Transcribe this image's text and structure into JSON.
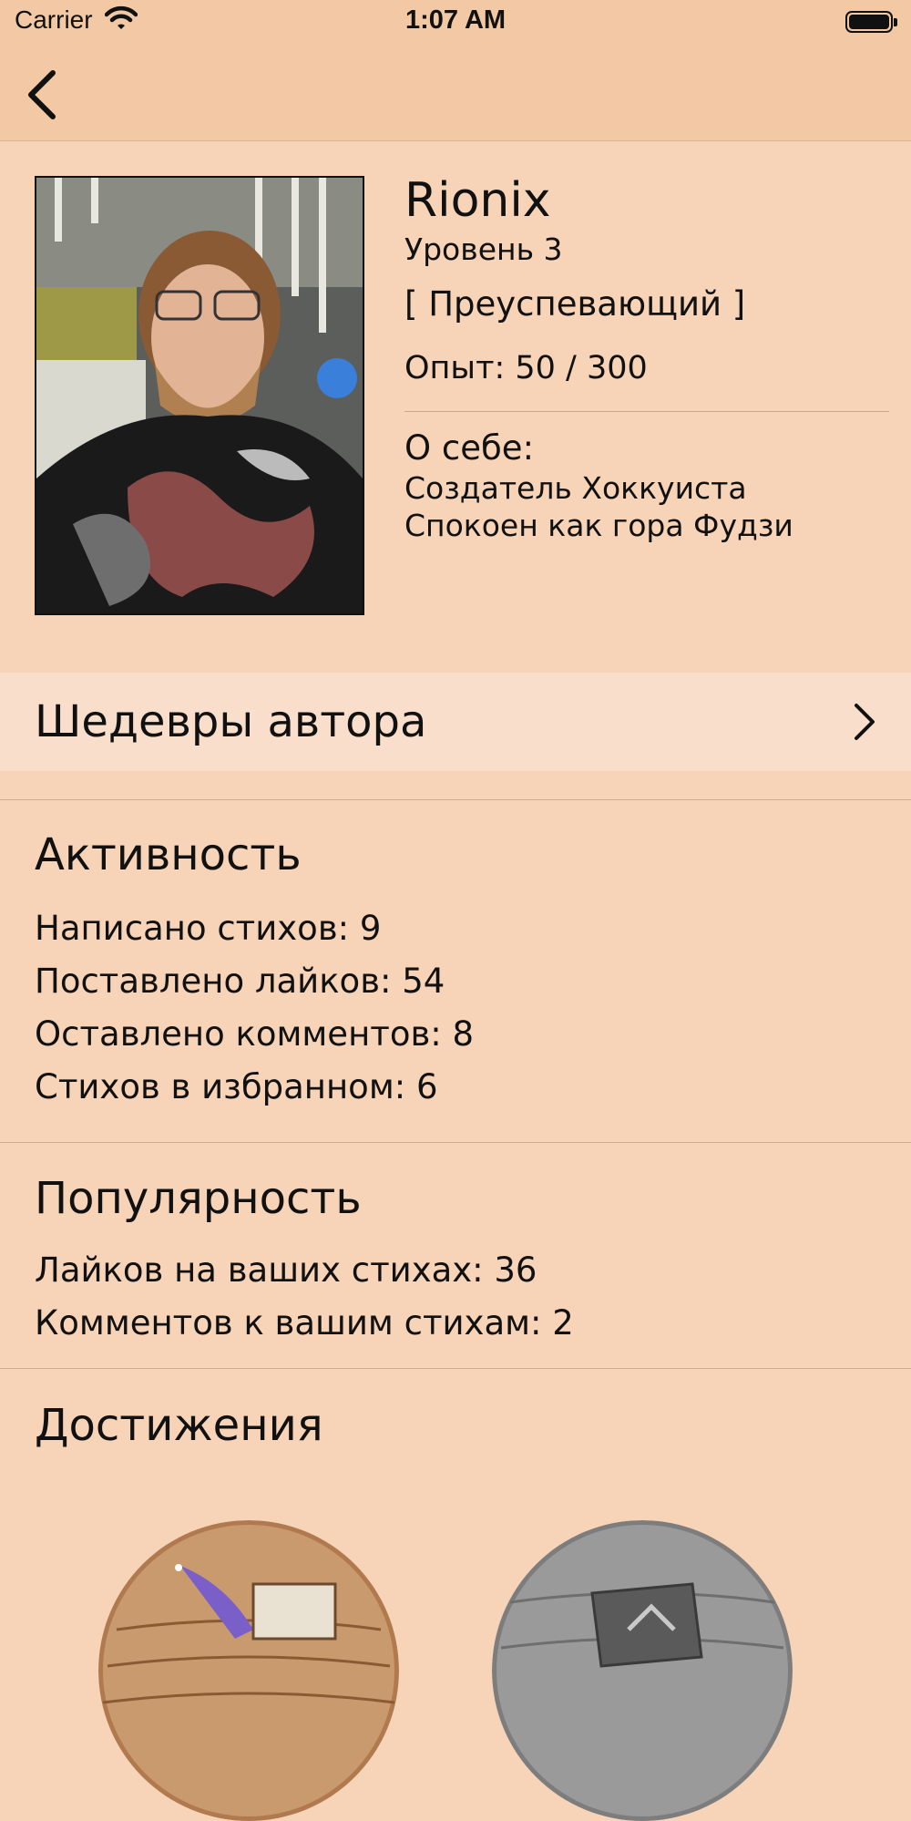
{
  "status_bar": {
    "carrier": "Carrier",
    "time": "1:07 AM"
  },
  "profile": {
    "name": "Rionix",
    "level": "Уровень 3",
    "rank": "[ Преуспевающий ]",
    "experience": "Опыт: 50 / 300",
    "about_label": "О себе:",
    "about_lines": [
      "Создатель Хоккуиста",
      "Спокоен как гора Фудзи"
    ]
  },
  "masterpieces": {
    "label": "Шедевры автора"
  },
  "activity": {
    "title": "Активность",
    "stats": [
      "Написано стихов: 9",
      "Поставлено лайков: 54",
      "Оставлено комментов: 8",
      "Стихов в избранном: 6"
    ]
  },
  "popularity": {
    "title": "Популярность",
    "stats": [
      "Лайков на ваших стихах: 36",
      "Комментов к вашим стихам: 2"
    ]
  },
  "achievements": {
    "title": "Достижения",
    "badges": [
      {
        "icon": "feather-quill-icon"
      },
      {
        "icon": "stone-tablet-icon"
      }
    ]
  },
  "colors": {
    "background": "#f7d3b7",
    "nav_bar": "#f2c9a4",
    "highlight_row": "#f9dfcb"
  }
}
